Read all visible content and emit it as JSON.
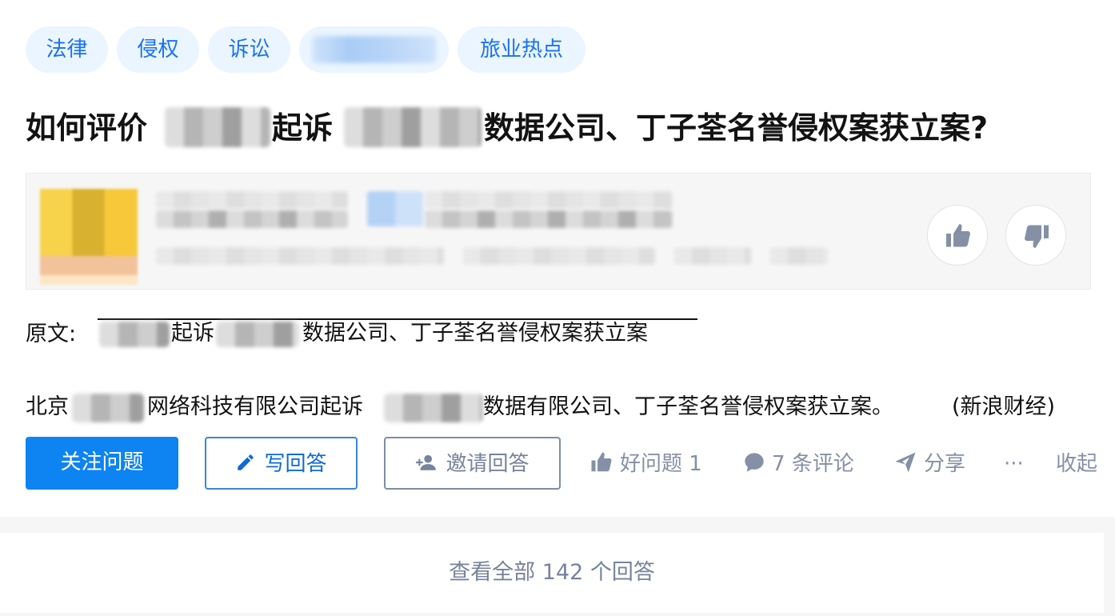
{
  "tags": [
    "法律",
    "侵权",
    "诉讼",
    "",
    "旅业热点"
  ],
  "title": {
    "part1": "如何评价",
    "part2": "起诉",
    "part3": "数据公司、丁子荃名誉侵权案获立案?"
  },
  "source": {
    "label": "原文:",
    "link_part1": "起诉",
    "link_part2": "数据公司、丁子荃名誉侵权案获立案"
  },
  "detail": {
    "part1": "北京",
    "part2": "网络科技有限公司起诉",
    "part3": "数据有限公司、丁子荃名誉侵权案获立案。",
    "part4": "(新浪财经)"
  },
  "actions": {
    "follow": "关注问题",
    "write": "写回答",
    "invite": "邀请回答",
    "good_question": "好问题 1",
    "comments": "7 条评论",
    "share": "分享",
    "more": "···",
    "collapse": "收起"
  },
  "view_all": "查看全部 142 个回答",
  "colors": {
    "primary": "#0e83f2",
    "tag_bg": "#ebf5ff",
    "tag_text": "#1772f6",
    "muted": "#8590a6"
  }
}
